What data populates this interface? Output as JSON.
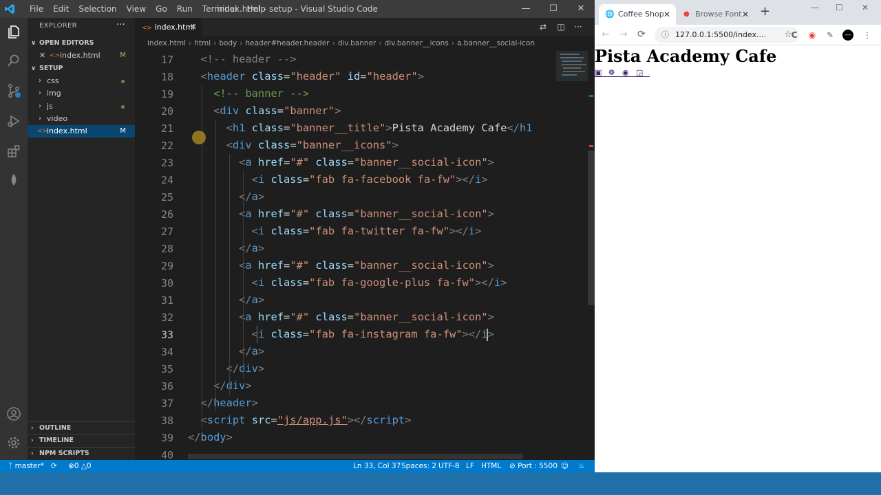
{
  "vscode": {
    "menu": [
      "File",
      "Edit",
      "Selection",
      "View",
      "Go",
      "Run",
      "Terminal",
      "Help"
    ],
    "window_title": "index.html - setup - Visual Studio Code",
    "sidebar": {
      "header": "EXPLORER",
      "open_editors": "OPEN EDITORS",
      "open_file": {
        "name": "index.html",
        "badge": "M"
      },
      "project": "SETUP",
      "items": [
        {
          "name": "css",
          "type": "folder",
          "modified": true
        },
        {
          "name": "img",
          "type": "folder",
          "modified": false
        },
        {
          "name": "js",
          "type": "folder",
          "modified": true
        },
        {
          "name": "video",
          "type": "folder",
          "modified": false
        },
        {
          "name": "index.html",
          "type": "file",
          "badge": "M"
        }
      ],
      "outline": "OUTLINE",
      "timeline": "TIMELINE",
      "npm_scripts": "NPM SCRIPTS"
    },
    "tab": {
      "label": "index.html"
    },
    "breadcrumbs": [
      "index.html",
      "html",
      "body",
      "header#header.header",
      "div.banner",
      "div.banner__icons",
      "a.banner__social-icon"
    ],
    "current_line": 33,
    "lines": [
      {
        "n": "17",
        "segs": [
          [
            "tg",
            "  <!-- header -->"
          ]
        ]
      },
      {
        "n": "18",
        "segs": [
          [
            "tg",
            "  <"
          ],
          [
            "tn",
            "header"
          ],
          [
            "tx",
            " "
          ],
          [
            "an",
            "class"
          ],
          [
            "tx",
            "="
          ],
          [
            "av",
            "\"header\""
          ],
          [
            "tx",
            " "
          ],
          [
            "an",
            "id"
          ],
          [
            "tx",
            "="
          ],
          [
            "av",
            "\"header\""
          ],
          [
            "tg",
            ">"
          ]
        ]
      },
      {
        "n": "19",
        "segs": [
          [
            "cm",
            "    <!-- banner -->"
          ]
        ]
      },
      {
        "n": "20",
        "segs": [
          [
            "tg",
            "    <"
          ],
          [
            "tn",
            "div"
          ],
          [
            "tx",
            " "
          ],
          [
            "an",
            "class"
          ],
          [
            "tx",
            "="
          ],
          [
            "av",
            "\"banner\""
          ],
          [
            "tg",
            ">"
          ]
        ]
      },
      {
        "n": "21",
        "segs": [
          [
            "tg",
            "      <"
          ],
          [
            "tn",
            "h1"
          ],
          [
            "tx",
            " "
          ],
          [
            "an",
            "class"
          ],
          [
            "tx",
            "="
          ],
          [
            "av",
            "\"banner__title\""
          ],
          [
            "tg",
            ">"
          ],
          [
            "tx",
            "Pista Academy Cafe"
          ],
          [
            "tg",
            "</"
          ],
          [
            "tn",
            "h1"
          ]
        ]
      },
      {
        "n": "22",
        "segs": [
          [
            "tg",
            "      <"
          ],
          [
            "tn",
            "div"
          ],
          [
            "tx",
            " "
          ],
          [
            "an",
            "class"
          ],
          [
            "tx",
            "="
          ],
          [
            "av",
            "\"banner__icons\""
          ],
          [
            "tg",
            ">"
          ]
        ]
      },
      {
        "n": "23",
        "segs": [
          [
            "tg",
            "        <"
          ],
          [
            "tn",
            "a"
          ],
          [
            "tx",
            " "
          ],
          [
            "an",
            "href"
          ],
          [
            "tx",
            "="
          ],
          [
            "av",
            "\"#\""
          ],
          [
            "tx",
            " "
          ],
          [
            "an",
            "class"
          ],
          [
            "tx",
            "="
          ],
          [
            "av",
            "\"banner__social-icon\""
          ],
          [
            "tg",
            ">"
          ]
        ]
      },
      {
        "n": "24",
        "segs": [
          [
            "tg",
            "          <"
          ],
          [
            "tn",
            "i"
          ],
          [
            "tx",
            " "
          ],
          [
            "an",
            "class"
          ],
          [
            "tx",
            "="
          ],
          [
            "av",
            "\"fab fa-facebook fa-fw\""
          ],
          [
            "tg",
            "></"
          ],
          [
            "tn",
            "i"
          ],
          [
            "tg",
            ">"
          ]
        ]
      },
      {
        "n": "25",
        "segs": [
          [
            "tg",
            "        </"
          ],
          [
            "tn",
            "a"
          ],
          [
            "tg",
            ">"
          ]
        ]
      },
      {
        "n": "26",
        "segs": [
          [
            "tg",
            "        <"
          ],
          [
            "tn",
            "a"
          ],
          [
            "tx",
            " "
          ],
          [
            "an",
            "href"
          ],
          [
            "tx",
            "="
          ],
          [
            "av",
            "\"#\""
          ],
          [
            "tx",
            " "
          ],
          [
            "an",
            "class"
          ],
          [
            "tx",
            "="
          ],
          [
            "av",
            "\"banner__social-icon\""
          ],
          [
            "tg",
            ">"
          ]
        ]
      },
      {
        "n": "27",
        "segs": [
          [
            "tg",
            "          <"
          ],
          [
            "tn",
            "i"
          ],
          [
            "tx",
            " "
          ],
          [
            "an",
            "class"
          ],
          [
            "tx",
            "="
          ],
          [
            "av",
            "\"fab fa-twitter fa-fw\""
          ],
          [
            "tg",
            "></"
          ],
          [
            "tn",
            "i"
          ],
          [
            "tg",
            ">"
          ]
        ]
      },
      {
        "n": "28",
        "segs": [
          [
            "tg",
            "        </"
          ],
          [
            "tn",
            "a"
          ],
          [
            "tg",
            ">"
          ]
        ]
      },
      {
        "n": "29",
        "segs": [
          [
            "tg",
            "        <"
          ],
          [
            "tn",
            "a"
          ],
          [
            "tx",
            " "
          ],
          [
            "an",
            "href"
          ],
          [
            "tx",
            "="
          ],
          [
            "av",
            "\"#\""
          ],
          [
            "tx",
            " "
          ],
          [
            "an",
            "class"
          ],
          [
            "tx",
            "="
          ],
          [
            "av",
            "\"banner__social-icon\""
          ],
          [
            "tg",
            ">"
          ]
        ]
      },
      {
        "n": "30",
        "segs": [
          [
            "tg",
            "          <"
          ],
          [
            "tn",
            "i"
          ],
          [
            "tx",
            " "
          ],
          [
            "an",
            "class"
          ],
          [
            "tx",
            "="
          ],
          [
            "av",
            "\"fab fa-google-plus fa-fw\""
          ],
          [
            "tg",
            "></"
          ],
          [
            "tn",
            "i"
          ],
          [
            "tg",
            ">"
          ]
        ]
      },
      {
        "n": "31",
        "segs": [
          [
            "tg",
            "        </"
          ],
          [
            "tn",
            "a"
          ],
          [
            "tg",
            ">"
          ]
        ]
      },
      {
        "n": "32",
        "segs": [
          [
            "tg",
            "        <"
          ],
          [
            "tn",
            "a"
          ],
          [
            "tx",
            " "
          ],
          [
            "an",
            "href"
          ],
          [
            "tx",
            "="
          ],
          [
            "av",
            "\"#\""
          ],
          [
            "tx",
            " "
          ],
          [
            "an",
            "class"
          ],
          [
            "tx",
            "="
          ],
          [
            "av",
            "\"banner__social-icon\""
          ],
          [
            "tg",
            ">"
          ]
        ]
      },
      {
        "n": "33",
        "segs": [
          [
            "tg",
            "          <"
          ],
          [
            "tn",
            "i"
          ],
          [
            "tx",
            " "
          ],
          [
            "an",
            "class"
          ],
          [
            "tx",
            "="
          ],
          [
            "av",
            "\"fab fa-instagram fa-fw\""
          ],
          [
            "tg",
            "></"
          ],
          [
            "tn",
            "i"
          ],
          [
            "tg",
            ">"
          ]
        ]
      },
      {
        "n": "34",
        "segs": [
          [
            "tg",
            "        </"
          ],
          [
            "tn",
            "a"
          ],
          [
            "tg",
            ">"
          ]
        ]
      },
      {
        "n": "35",
        "segs": [
          [
            "tg",
            "      </"
          ],
          [
            "tn",
            "div"
          ],
          [
            "tg",
            ">"
          ]
        ]
      },
      {
        "n": "36",
        "segs": [
          [
            "tg",
            "    </"
          ],
          [
            "tn",
            "div"
          ],
          [
            "tg",
            ">"
          ]
        ]
      },
      {
        "n": "37",
        "segs": [
          [
            "tg",
            "  </"
          ],
          [
            "tn",
            "header"
          ],
          [
            "tg",
            ">"
          ]
        ]
      },
      {
        "n": "38",
        "segs": [
          [
            "tg",
            "  <"
          ],
          [
            "tn",
            "script"
          ],
          [
            "tx",
            " "
          ],
          [
            "an",
            "src"
          ],
          [
            "tx",
            "="
          ],
          [
            "av",
            "\"js/app.js\""
          ],
          [
            "tg",
            "></"
          ],
          [
            "tn",
            "script"
          ],
          [
            "tg",
            ">"
          ]
        ]
      },
      {
        "n": "39",
        "segs": [
          [
            "tg",
            "</"
          ],
          [
            "tn",
            "body"
          ],
          [
            "tg",
            ">"
          ]
        ]
      },
      {
        "n": "40",
        "segs": []
      }
    ],
    "status": {
      "branch": "master*",
      "errors": "0",
      "warnings": "0",
      "position": "Ln 33, Col 37",
      "spaces": "Spaces: 2",
      "encoding": "UTF-8",
      "eol": "LF",
      "language": "HTML",
      "port": "Port : 5500"
    }
  },
  "chrome": {
    "tabs": [
      {
        "label": "Coffee Shop",
        "active": true
      },
      {
        "label": "Browse Font",
        "active": false
      }
    ],
    "url": "127.0.0.1:5500/index....",
    "page": {
      "title": "Pista Academy Cafe",
      "social_icons": [
        "facebook-icon",
        "twitter-icon",
        "google-plus-icon",
        "instagram-icon"
      ]
    }
  },
  "colors": {
    "status_bar": "#007acc",
    "selection": "#094771",
    "tag": "#569cd6",
    "attribute": "#9cdcfe",
    "string": "#ce9178"
  }
}
